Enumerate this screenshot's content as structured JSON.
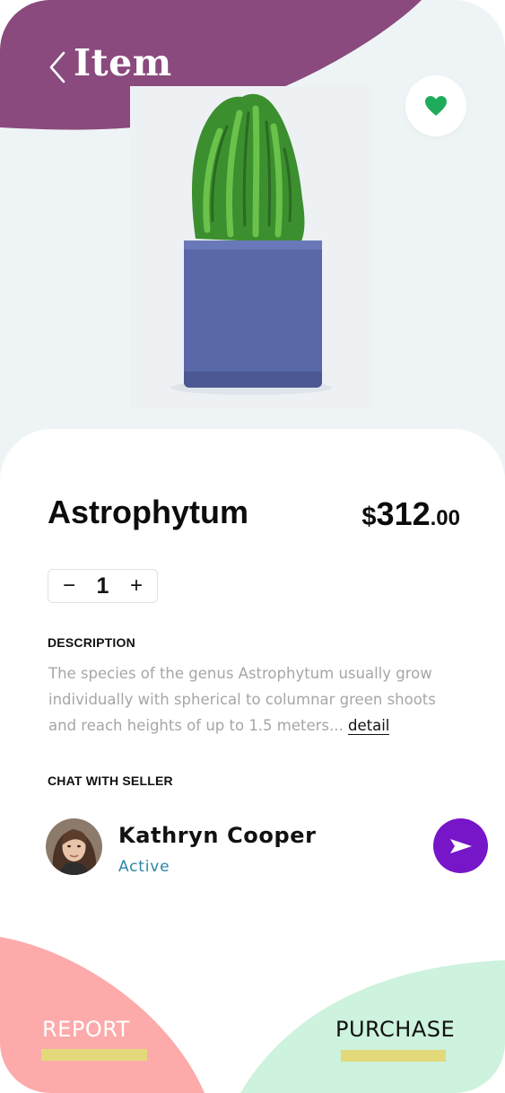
{
  "header": {
    "title": "Item",
    "back_icon": "chevron-left-icon",
    "favorite_icon": "heart-icon",
    "colors": {
      "header_blob": "#8a4a7d",
      "favorite_heart": "#1fac5a"
    }
  },
  "product": {
    "name": "Astrophytum",
    "price_currency": "$",
    "price_whole": "312",
    "price_cents": ".00",
    "quantity": "1",
    "decrement_symbol": "−",
    "increment_symbol": "+"
  },
  "description": {
    "label": "DESCRIPTION",
    "text": "The species of the genus Astrophytum usually grow individually with spherical to columnar green shoots and reach heights of up to 1.5 meters...",
    "link_label": "detail"
  },
  "seller": {
    "section_label": "CHAT WITH SELLER",
    "name": "Kathryn Cooper",
    "status": "Active",
    "send_icon": "send-icon",
    "colors": {
      "status": "#2a86a5",
      "send_button": "#7715c9"
    }
  },
  "actions": {
    "report_label": "REPORT",
    "purchase_label": "PURCHASE",
    "colors": {
      "report_bg": "#fdaaaa",
      "purchase_bg": "#cdf2dd",
      "underline": "#e4d97a"
    }
  }
}
